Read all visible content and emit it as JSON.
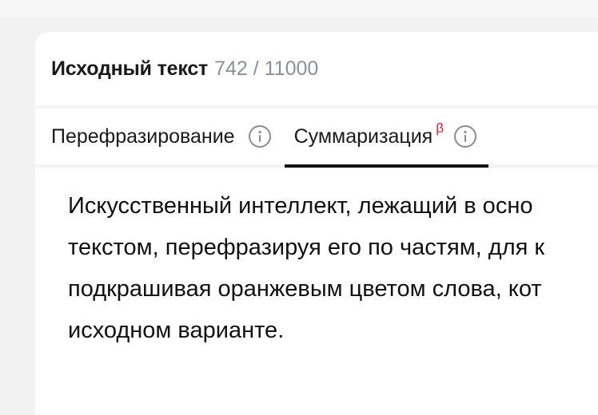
{
  "header": {
    "title": "Исходный текст",
    "counter": "742 / 11000"
  },
  "tabs": [
    {
      "label": "Перефразирование",
      "icon": "info-icon",
      "active": false
    },
    {
      "label": "Суммаризация",
      "badge": "β",
      "icon": "info-icon",
      "active": true
    }
  ],
  "colors": {
    "beta_badge": "#e8182a",
    "active_underline": "#111111",
    "counter": "#8a8f99"
  },
  "content": {
    "lines": [
      "Искусственный интеллект, лежащий в осно",
      "текстом, перефразируя его по частям, для к",
      "подкрашивая оранжевым цветом слова, кот",
      "исходном варианте."
    ]
  }
}
